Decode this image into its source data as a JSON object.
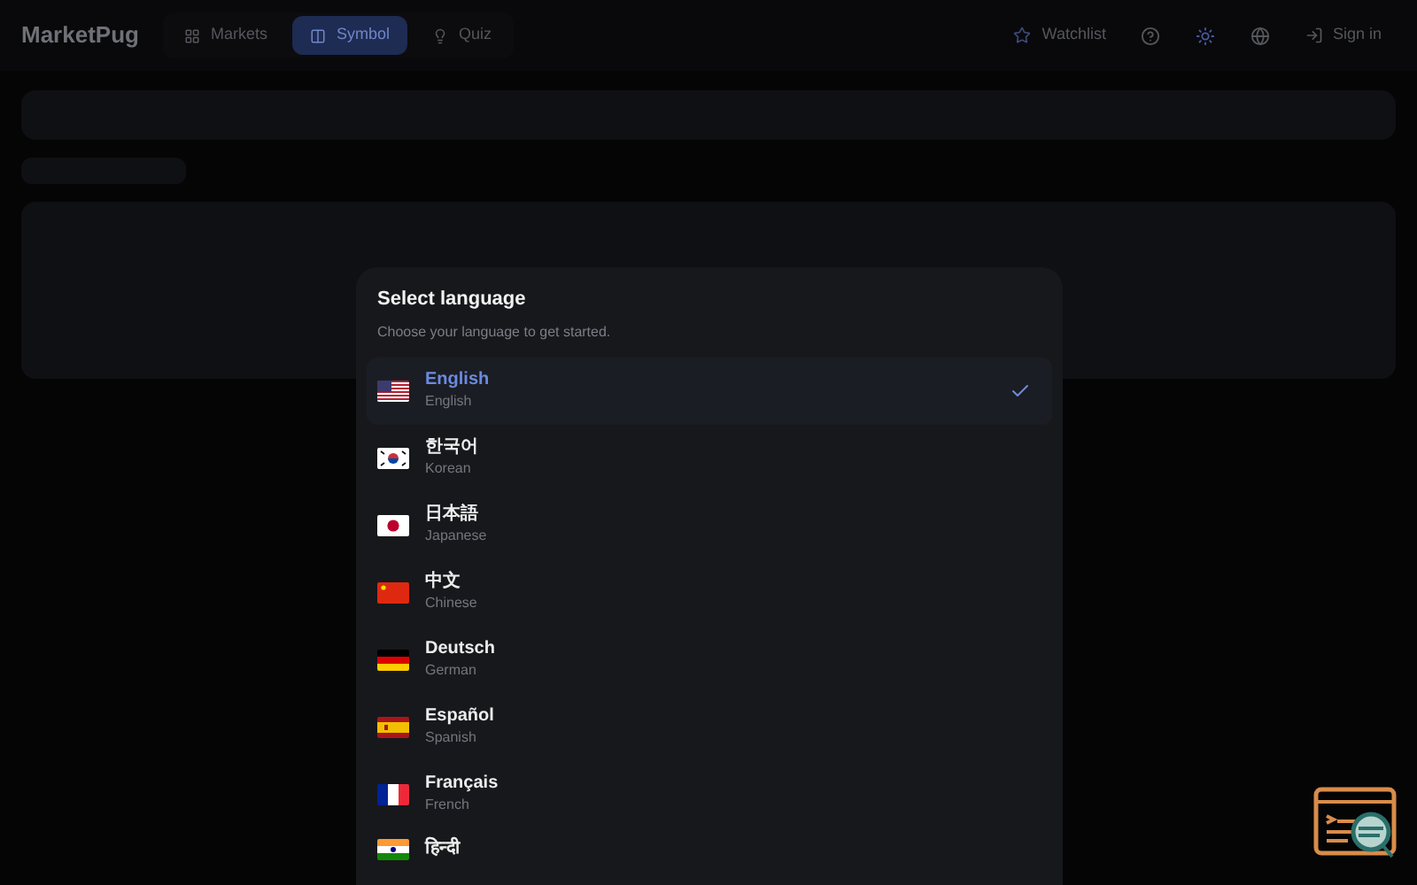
{
  "brand": "MarketPug",
  "nav": [
    {
      "label": "Markets",
      "selected": false
    },
    {
      "label": "Symbol",
      "selected": true
    },
    {
      "label": "Quiz",
      "selected": false
    }
  ],
  "actions": {
    "watchlist": "Watchlist",
    "sign_in": "Sign in"
  },
  "dialog": {
    "title": "Select language",
    "subtitle": "Choose your language to get started.",
    "languages": [
      {
        "name": "English",
        "english": "English",
        "selected": true
      },
      {
        "name": "한국어",
        "english": "Korean",
        "selected": false
      },
      {
        "name": "日本語",
        "english": "Japanese",
        "selected": false
      },
      {
        "name": "中文",
        "english": "Chinese",
        "selected": false
      },
      {
        "name": "Deutsch",
        "english": "German",
        "selected": false
      },
      {
        "name": "Español",
        "english": "Spanish",
        "selected": false
      },
      {
        "name": "Français",
        "english": "French",
        "selected": false
      },
      {
        "name": "हिन्दी",
        "selected": false
      }
    ]
  }
}
